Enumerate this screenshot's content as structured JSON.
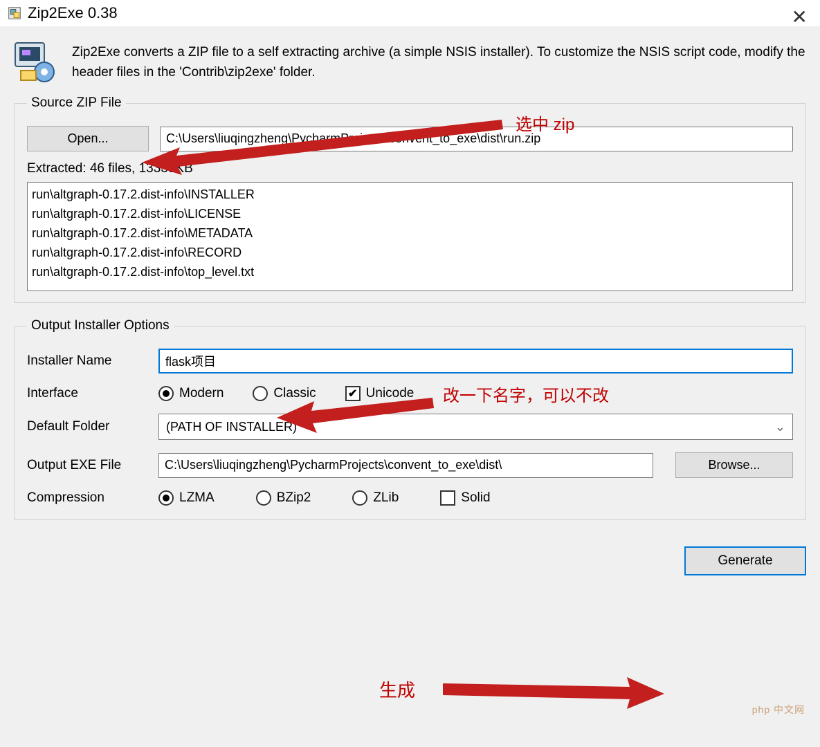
{
  "window": {
    "title": "Zip2Exe 0.38"
  },
  "header": {
    "text": "Zip2Exe converts a ZIP file to a self extracting archive (a simple NSIS installer). To customize the NSIS script code, modify the header files in the 'Contrib\\zip2exe' folder."
  },
  "source_group": {
    "legend": "Source ZIP File",
    "open_label": "Open...",
    "path_value": "C:\\Users\\liuqingzheng\\PycharmProjects\\convent_to_exe\\dist\\run.zip",
    "extracted_label": "Extracted: 46 files, 13339KB",
    "file_list": [
      "run\\altgraph-0.17.2.dist-info\\INSTALLER",
      "run\\altgraph-0.17.2.dist-info\\LICENSE",
      "run\\altgraph-0.17.2.dist-info\\METADATA",
      "run\\altgraph-0.17.2.dist-info\\RECORD",
      "run\\altgraph-0.17.2.dist-info\\top_level.txt"
    ]
  },
  "output_group": {
    "legend": "Output Installer Options",
    "labels": {
      "installer_name": "Installer Name",
      "interface": "Interface",
      "default_folder": "Default Folder",
      "output_exe": "Output EXE File",
      "compression": "Compression"
    },
    "installer_name_value": "flask项目",
    "interface_options": {
      "modern": "Modern",
      "classic": "Classic",
      "unicode": "Unicode",
      "selected": "modern",
      "unicode_checked": true
    },
    "default_folder_value": "(PATH OF INSTALLER)",
    "output_exe_value": "C:\\Users\\liuqingzheng\\PycharmProjects\\convent_to_exe\\dist\\",
    "browse_label": "Browse...",
    "compression_options": {
      "lzma": "LZMA",
      "bzip2": "BZip2",
      "zlib": "ZLib",
      "solid": "Solid",
      "selected": "lzma",
      "solid_checked": false
    }
  },
  "generate_label": "Generate",
  "annotations": {
    "select_zip": "选中 zip",
    "rename": "改一下名字，可以不改",
    "generate": "生成"
  },
  "watermark": "php 中文网"
}
